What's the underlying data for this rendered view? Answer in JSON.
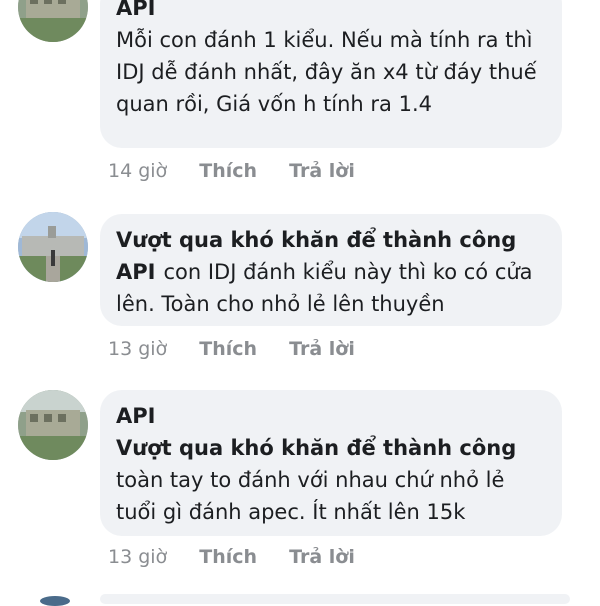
{
  "comments": [
    {
      "author": "API",
      "text": "Mỗi con đánh 1 kiểu. Nếu mà tính ra thì IDJ dễ đánh nhất, đây ăn x4 từ đáy thuế quan rồi, Giá vốn h tính ra 1.4",
      "time": "14 giờ",
      "like_label": "Thích",
      "reply_label": "Trả lời"
    },
    {
      "author": "Vượt qua khó khăn để thành công",
      "mention": "API",
      "text": "con IDJ đánh kiểu này thì ko có cửa lên. Toàn cho nhỏ lẻ lên thuyền",
      "time": "13 giờ",
      "like_label": "Thích",
      "reply_label": "Trả lời"
    },
    {
      "author": "API",
      "mention": "Vượt qua khó khăn để thành công",
      "text": "toàn tay to đánh với nhau chứ nhỏ lẻ tuổi gì đánh apec. Ít nhất lên 15k",
      "time": "13 giờ",
      "like_label": "Thích",
      "reply_label": "Trả lời"
    }
  ],
  "colors": {
    "bubble_bg": "#f0f2f5",
    "text": "#1c1e21",
    "meta": "#8a8d91"
  },
  "icons": [
    "avatar-photo"
  ]
}
